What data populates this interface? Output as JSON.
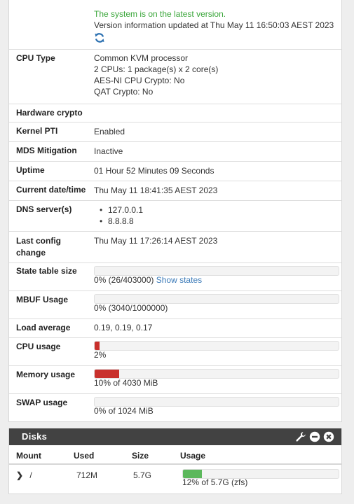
{
  "system": {
    "version_status": "The system is on the latest version.",
    "version_updated": "Version information updated at Thu May 11 16:50:03 AEST 2023",
    "rows": {
      "cpu_type": {
        "label": "CPU Type",
        "line1": "Common KVM processor",
        "line2": "2 CPUs: 1 package(s) x 2 core(s)",
        "line3": "AES-NI CPU Crypto: No",
        "line4": "QAT Crypto: No"
      },
      "hardware_crypto": {
        "label": "Hardware crypto",
        "value": ""
      },
      "kernel_pti": {
        "label": "Kernel PTI",
        "value": "Enabled"
      },
      "mds": {
        "label": "MDS Mitigation",
        "value": "Inactive"
      },
      "uptime": {
        "label": "Uptime",
        "value": "01 Hour 52 Minutes 09 Seconds"
      },
      "datetime": {
        "label": "Current date/time",
        "value": "Thu May 11 18:41:35 AEST 2023"
      },
      "dns": {
        "label": "DNS server(s)",
        "servers": [
          "127.0.0.1",
          "8.8.8.8"
        ]
      },
      "last_config": {
        "label_line1": "Last config",
        "label_line2": "change",
        "value": "Thu May 11 17:26:14 AEST 2023"
      },
      "state_table": {
        "label": "State table size",
        "value": "0% (26/403000)",
        "link": "Show states",
        "fraction": 0.0
      },
      "mbuf": {
        "label": "MBUF Usage",
        "value": "0% (3040/1000000)",
        "fraction": 0.0
      },
      "load_avg": {
        "label": "Load average",
        "value": "0.19, 0.19, 0.17"
      },
      "cpu_usage": {
        "label": "CPU usage",
        "value": "2%",
        "fraction": 0.02
      },
      "memory_usage": {
        "label": "Memory usage",
        "value": "10% of 4030 MiB",
        "fraction": 0.1
      },
      "swap_usage": {
        "label": "SWAP usage",
        "value": "0% of 1024 MiB",
        "fraction": 0.0
      }
    }
  },
  "disks": {
    "title": "Disks",
    "columns": [
      "Mount",
      "Used",
      "Size",
      "Usage"
    ],
    "rows": [
      {
        "mount": "/",
        "used": "712M",
        "size": "5.7G",
        "usage_text": "12% of 5.7G (zfs)",
        "fraction": 0.12
      }
    ]
  },
  "colors": {
    "bar_red": "#c9302c",
    "bar_green": "#5cb85c",
    "link": "#3b7ab8",
    "status_green": "#3aa63a",
    "header_dark": "#424242"
  }
}
